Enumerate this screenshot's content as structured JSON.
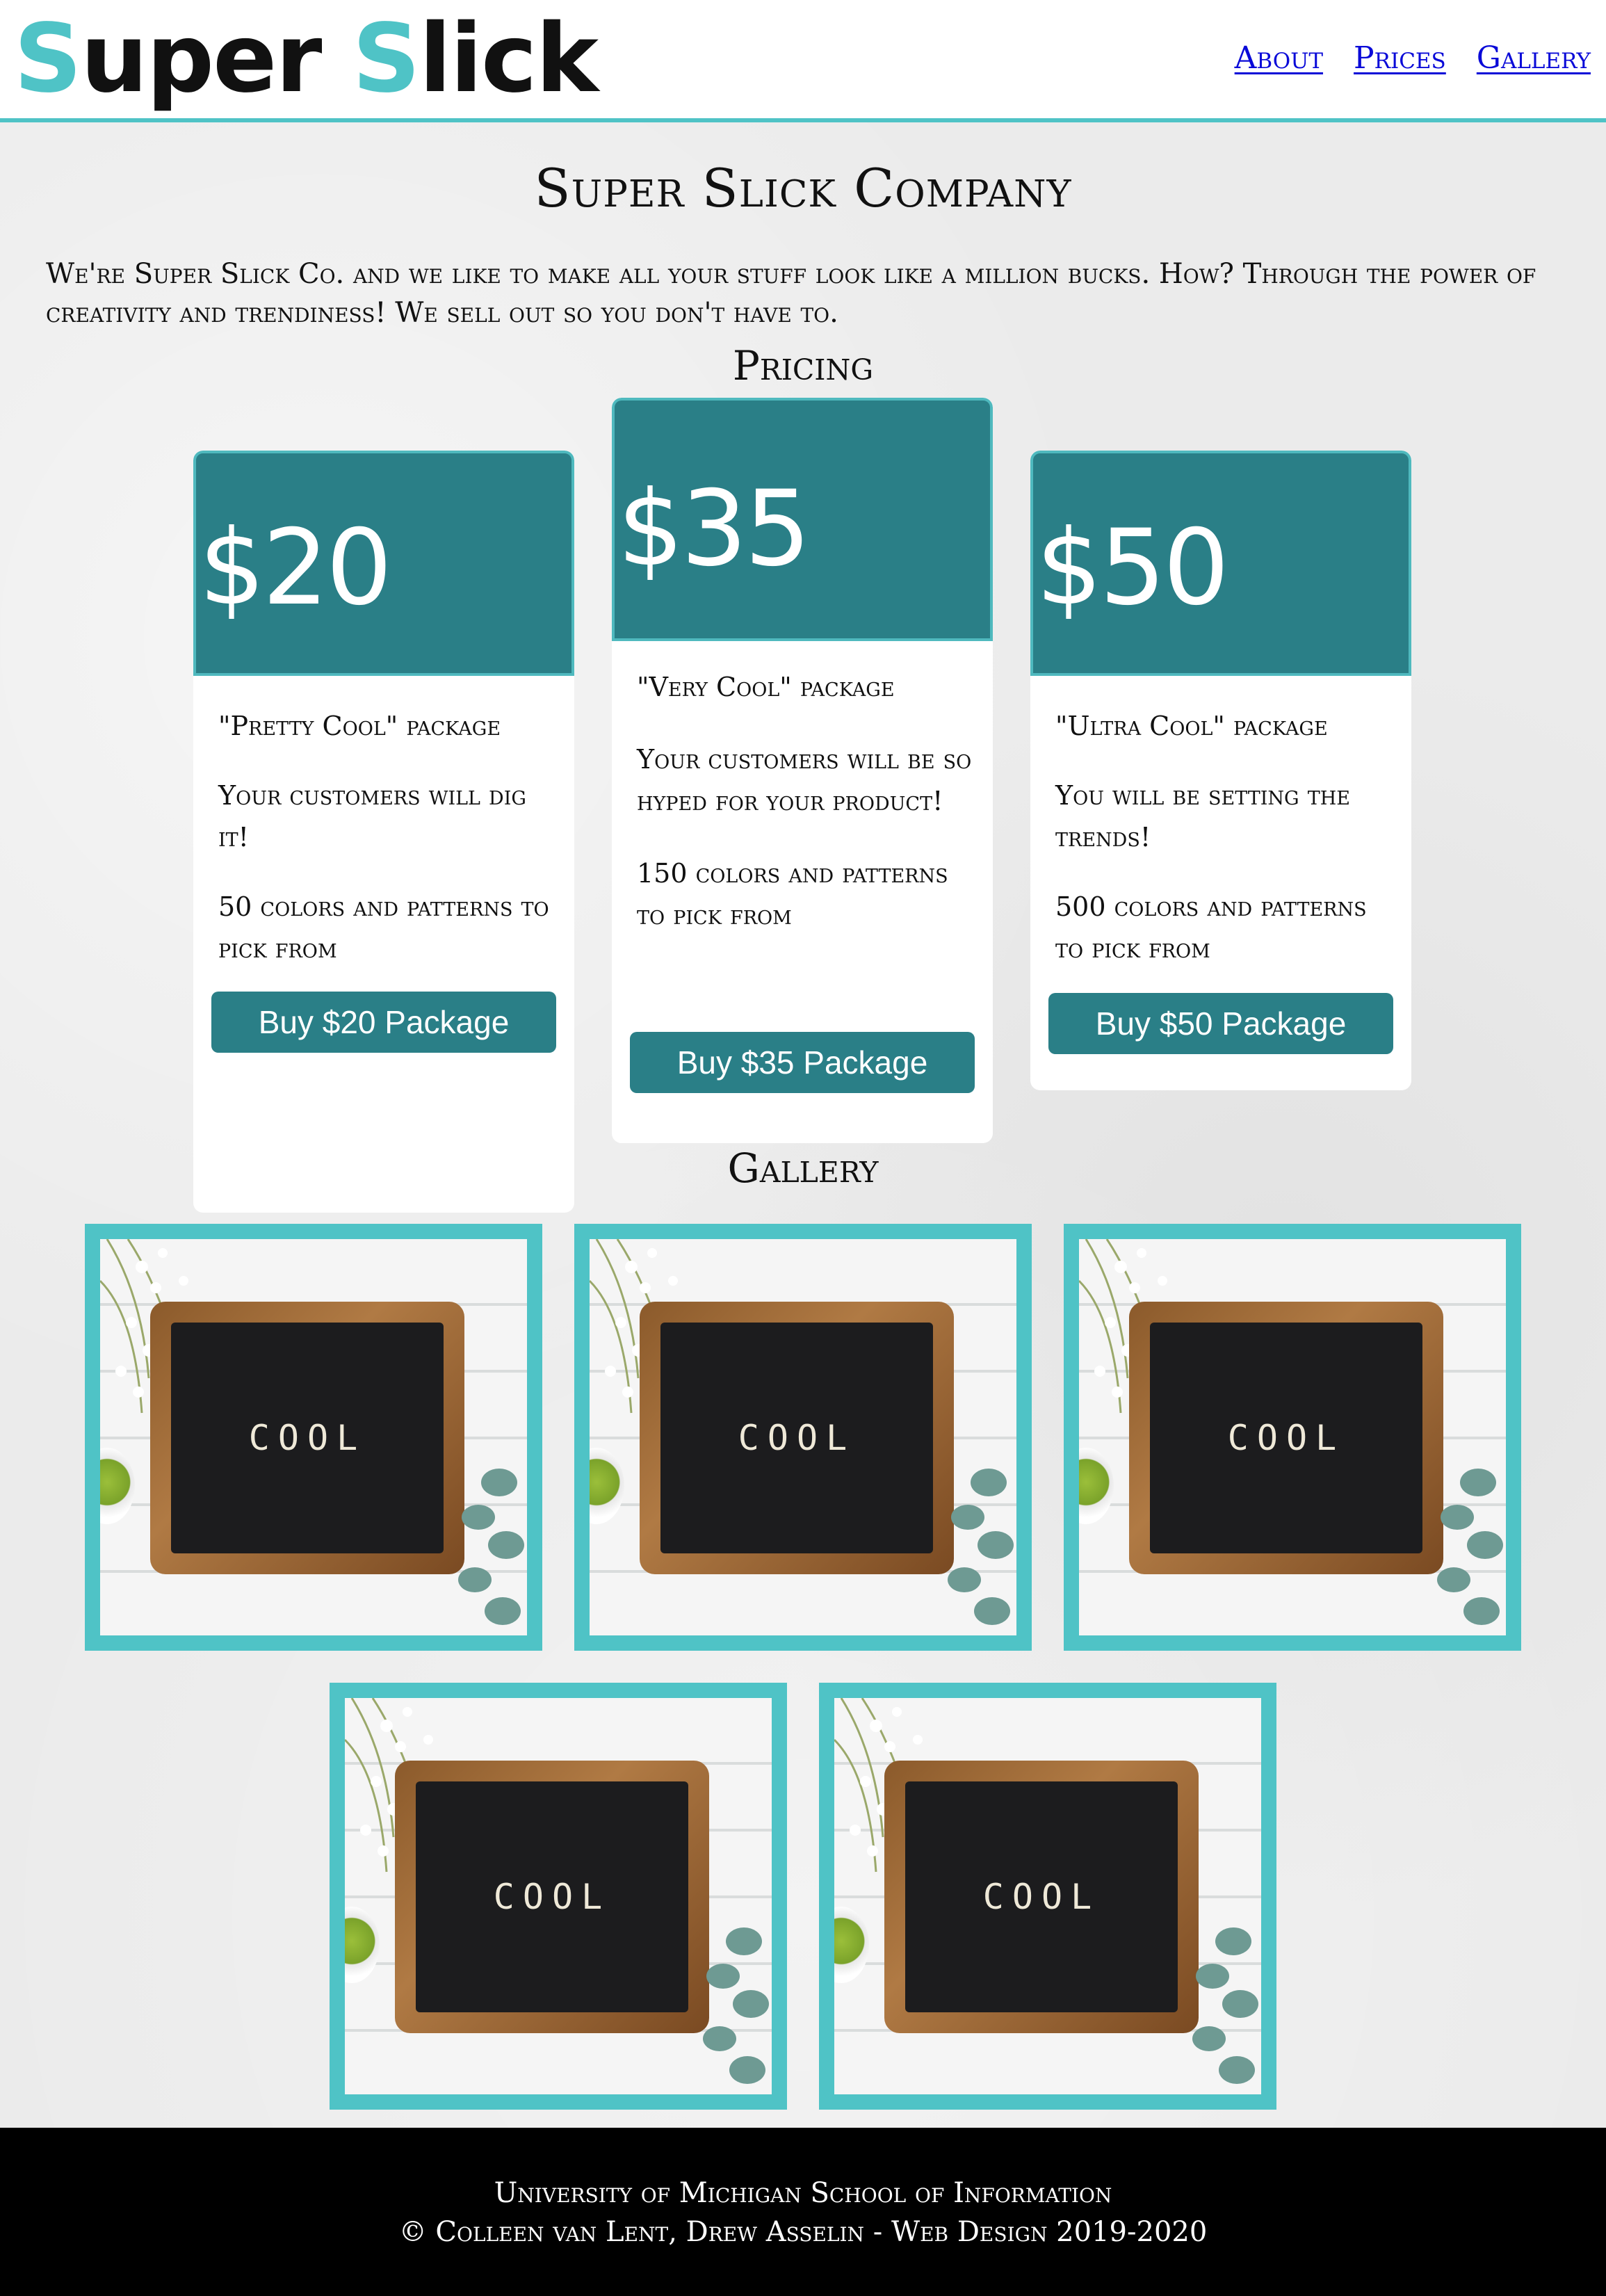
{
  "header": {
    "logo_part1": "Super ",
    "logo_part2": "Slick",
    "nav": [
      "About",
      "Prices",
      "Gallery"
    ]
  },
  "main": {
    "title": "Super Slick Company",
    "intro": "We're Super Slick Co. and we like to make all your stuff look like a million bucks. How? Through the power of creativity and trendiness! We sell out so you don't have to.",
    "pricing_title": "Pricing",
    "gallery_title": "Gallery"
  },
  "pricing": [
    {
      "price": "$20",
      "package": "\"Pretty Cool\" package",
      "tagline": "Your customers will dig it!",
      "colors": "50 colors and patterns to pick from",
      "button": "Buy $20 Package"
    },
    {
      "price": "$35",
      "package": "\"Very Cool\" package",
      "tagline": "Your customers will be so hyped for your product!",
      "colors": "150 colors and patterns to pick from",
      "button": "Buy $35 Package"
    },
    {
      "price": "$50",
      "package": "\"Ultra Cool\" package",
      "tagline": "You will be setting the trends!",
      "colors": "500 colors and patterns to pick from",
      "button": "Buy $50 Package"
    }
  ],
  "gallery": {
    "board_text": "COOL",
    "count": 5
  },
  "footer": {
    "line1": "University of Michigan School of Information",
    "line2": "© Colleen van Lent, Drew Asselin - Web Design 2019-2020"
  },
  "colors": {
    "teal": "#4fc3c6",
    "dark_teal": "#2a7f87",
    "link": "#0a0ad8"
  }
}
